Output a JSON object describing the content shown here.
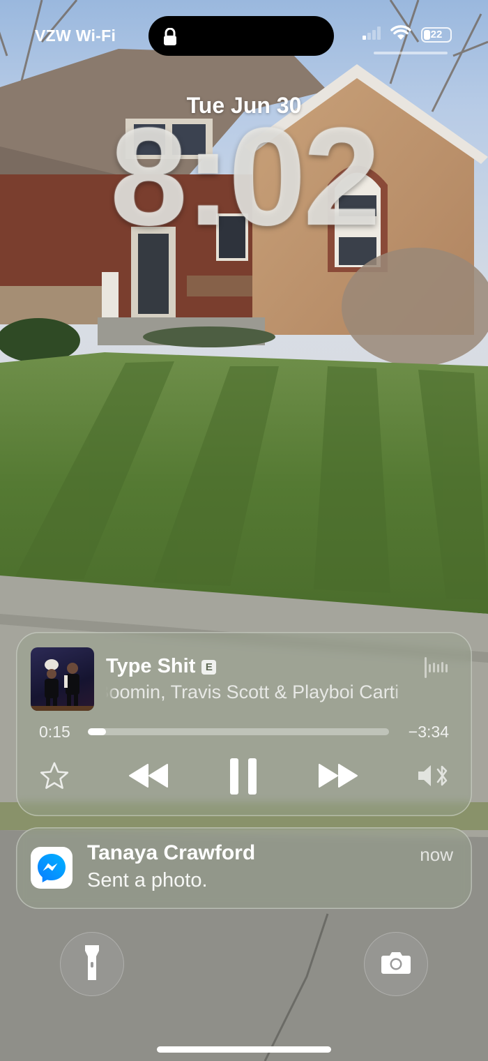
{
  "status_bar": {
    "carrier": "VZW Wi-Fi",
    "battery_level": "22",
    "icons": [
      "lock-icon",
      "cellular-signal-icon",
      "wifi-icon",
      "battery-icon"
    ]
  },
  "lock_screen": {
    "date": "Tue Jun 30",
    "time": "8:02"
  },
  "now_playing": {
    "title": "Type Shit",
    "explicit_badge": "E",
    "artist": "Metro Boomin, Travis Scott & Playboi Carti",
    "elapsed": "0:15",
    "remaining": "−3:34",
    "progress_fraction": 0.061,
    "controls": [
      "star-icon",
      "rewind-icon",
      "pause-icon",
      "fast-forward-icon",
      "audio-output-icon"
    ]
  },
  "notification": {
    "app_icon": "messenger-icon",
    "sender": "Tanaya Crawford",
    "message": "Sent a photo.",
    "time": "now"
  },
  "quick_actions": {
    "left": "flashlight-icon",
    "right": "camera-icon"
  }
}
